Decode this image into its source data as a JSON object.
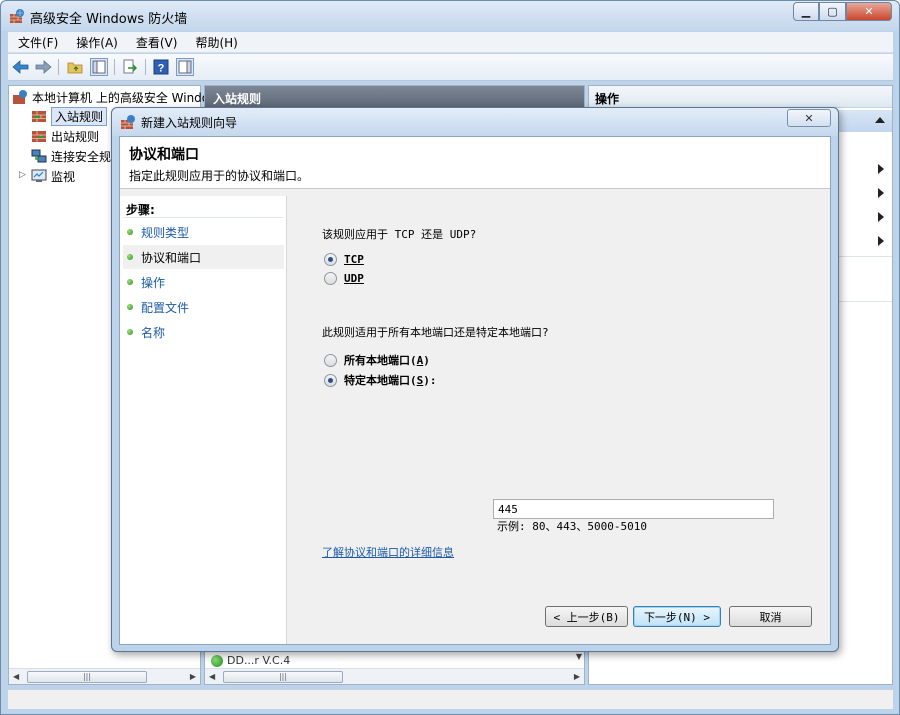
{
  "window": {
    "title": "高级安全 Windows 防火墙",
    "min_glyph": "▁",
    "max_glyph": "▢",
    "close_glyph": "✕"
  },
  "menubar": [
    {
      "label": "文件(F)"
    },
    {
      "label": "操作(A)"
    },
    {
      "label": "查看(V)"
    },
    {
      "label": "帮助(H)"
    }
  ],
  "tree": {
    "root": "本地计算机 上的高级安全 Windows",
    "items": [
      {
        "label": "入站规则",
        "selected": true
      },
      {
        "label": "出站规则"
      },
      {
        "label": "连接安全规则"
      },
      {
        "label": "监视"
      }
    ]
  },
  "center": {
    "header": "入站规则",
    "row_partial": "DD...r V.C.4"
  },
  "actions": {
    "header": "操作"
  },
  "dialog": {
    "title": "新建入站规则向导",
    "close_glyph": "✕",
    "heading": "协议和端口",
    "subheading": "指定此规则应用于的协议和端口。",
    "steps_title": "步骤:",
    "steps": [
      {
        "label": "规则类型"
      },
      {
        "label": "协议和端口",
        "current": true
      },
      {
        "label": "操作"
      },
      {
        "label": "配置文件"
      },
      {
        "label": "名称"
      }
    ],
    "protocol_question": "该规则应用于 TCP 还是 UDP?",
    "protocol_options": [
      {
        "label": "TCP",
        "selected": true
      },
      {
        "label": "UDP",
        "selected": false
      }
    ],
    "port_question": "此规则适用于所有本地端口还是特定本地端口?",
    "port_options": [
      {
        "label": "所有本地端口",
        "key": "A",
        "selected": false
      },
      {
        "label": "特定本地端口",
        "key": "S",
        "selected": true
      }
    ],
    "port_value": "445",
    "port_example": "示例: 80、443、5000-5010",
    "learn_more": "了解协议和端口的详细信息",
    "buttons": {
      "back": "< 上一步(B)",
      "next": "下一步(N) >",
      "cancel": "取消"
    }
  },
  "colors": {
    "frame": "#bcd3ea",
    "link": "#1c5aa8",
    "center_header": "#6b7483"
  }
}
